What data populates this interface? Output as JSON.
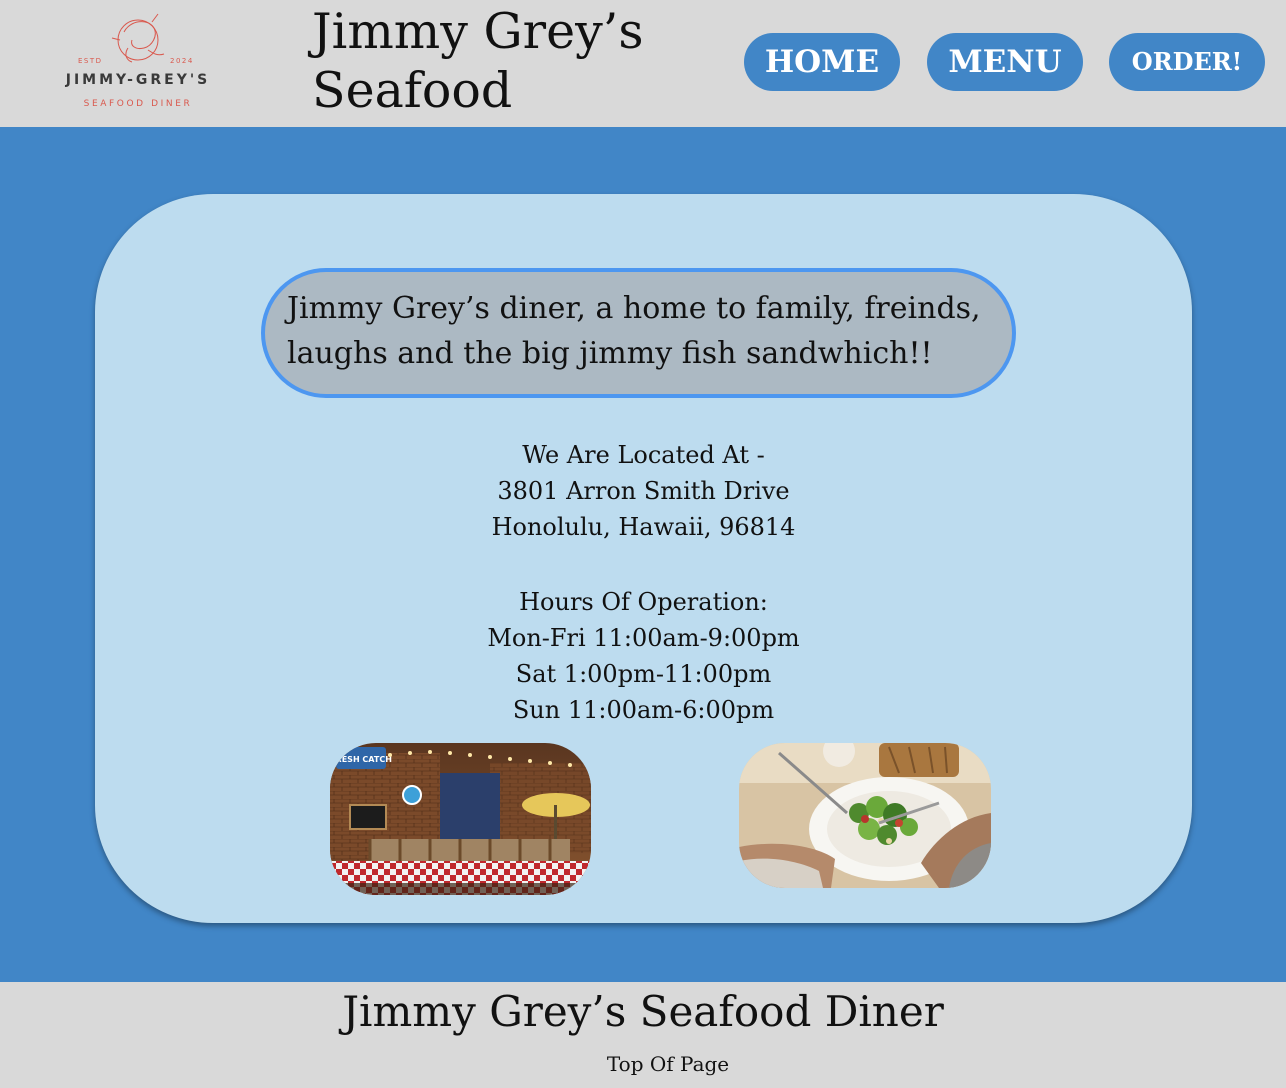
{
  "header": {
    "logo": {
      "estd": "ESTD",
      "year": "2024",
      "name": "JIMMY-GREY'S",
      "subtitle": "SEAFOOD DINER"
    },
    "title_line1": "Jimmy Grey’s",
    "title_line2": "Seafood",
    "nav": {
      "home": "HOME",
      "menu": "MENU",
      "order": "ORDER!"
    }
  },
  "main": {
    "tagline_line1": "Jimmy Grey’s diner, a home to family, freinds,",
    "tagline_line2": "laughs and the big jimmy fish sandwhich!!",
    "location": {
      "heading": "We Are Located At -",
      "street": "3801 Arron Smith Drive",
      "city": "Honolulu, Hawaii, 96814"
    },
    "hours": {
      "heading": "Hours Of Operation:",
      "weekdays": "Mon-Fri 11:00am-9:00pm",
      "saturday": "Sat 1:00pm-11:00pm",
      "sunday": "Sun 11:00am-6:00pm"
    },
    "interior_sign": "FRESH CATCH"
  },
  "footer": {
    "title": "Jimmy Grey’s Seafood Diner",
    "top_link": "Top Of Page"
  },
  "colors": {
    "page_background": "#4186c7",
    "header_background": "#d9d9d9",
    "card_background": "#bddcef",
    "tagline_background": "#acb9c3",
    "tagline_border": "#4d97f0",
    "button_background": "#4186c7",
    "logo_accent": "#d9594e"
  }
}
